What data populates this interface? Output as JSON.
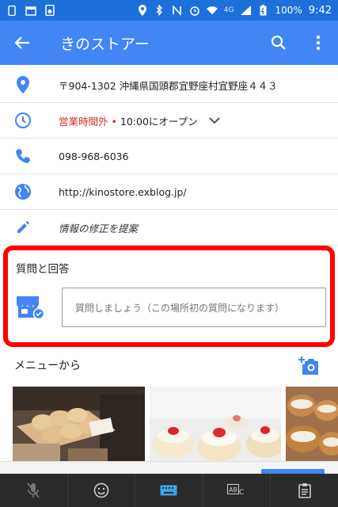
{
  "status_bar": {
    "network": "4G",
    "battery": "100%",
    "time": "9:42"
  },
  "app_bar": {
    "title": "きのストアー"
  },
  "info": {
    "address": "〒904-1302 沖縄県国頭郡宜野座村宜野座４４３",
    "hours_status": "営業時間外",
    "hours_dot": "•",
    "hours_open": "10:00にオープン",
    "phone": "098-968-6036",
    "website": "http://kinostore.exblog.jp/",
    "suggest_edit": "情報の修正を提案"
  },
  "qa": {
    "title": "質問と回答",
    "placeholder": "質問しましょう（この場所初の質問になります）"
  },
  "menu": {
    "title": "メニューから"
  },
  "colors": {
    "status_bar": "#1e6fd9",
    "app_bar": "#4285f4",
    "icon_blue": "#4285f4",
    "closed_red": "#d93025",
    "highlight_red": "#ff0000"
  }
}
